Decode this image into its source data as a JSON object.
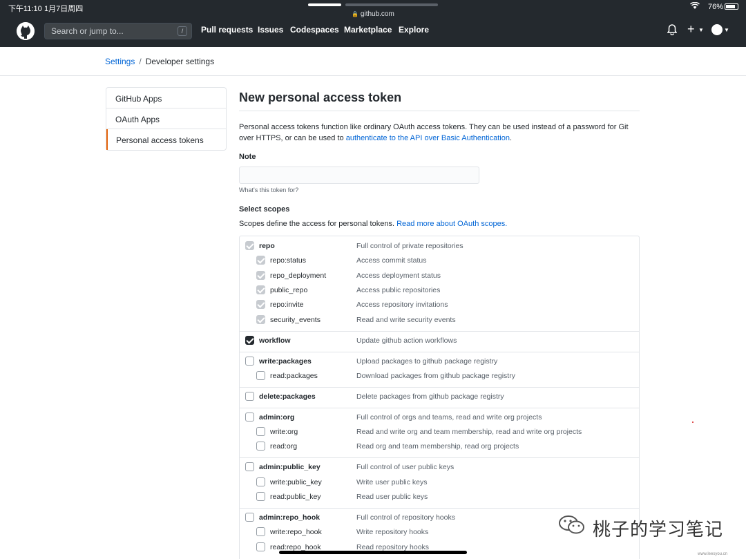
{
  "status_bar": {
    "time": "下午11:10",
    "date": "1月7日周四",
    "url": "github.com",
    "battery": "76%"
  },
  "header": {
    "search_placeholder": "Search or jump to...",
    "search_shortcut": "/",
    "nav": [
      "Pull requests",
      "Issues",
      "Codespaces",
      "Marketplace",
      "Explore"
    ],
    "plus": "+"
  },
  "breadcrumb": {
    "parent": "Settings",
    "separator": "/",
    "current": "Developer settings"
  },
  "sidebar": {
    "items": [
      {
        "label": "GitHub Apps",
        "active": false
      },
      {
        "label": "OAuth Apps",
        "active": false
      },
      {
        "label": "Personal access tokens",
        "active": true
      }
    ]
  },
  "page": {
    "title": "New personal access token",
    "description": "Personal access tokens function like ordinary OAuth access tokens. They can be used instead of a password for Git over HTTPS, or can be used to",
    "description_link": "authenticate to the API over Basic Authentication",
    "description_end": ".",
    "note_label": "Note",
    "note_value": "",
    "note_hint": "What's this token for?",
    "scopes_label": "Select scopes",
    "scopes_description": "Scopes define the access for personal tokens.",
    "scopes_link": "Read more about OAuth scopes."
  },
  "scopes": [
    {
      "name": "repo",
      "description": "Full control of private repositories",
      "state": "disabled-checked",
      "children": [
        {
          "name": "repo:status",
          "description": "Access commit status",
          "state": "disabled-checked"
        },
        {
          "name": "repo_deployment",
          "description": "Access deployment status",
          "state": "disabled-checked"
        },
        {
          "name": "public_repo",
          "description": "Access public repositories",
          "state": "disabled-checked"
        },
        {
          "name": "repo:invite",
          "description": "Access repository invitations",
          "state": "disabled-checked"
        },
        {
          "name": "security_events",
          "description": "Read and write security events",
          "state": "disabled-checked"
        }
      ]
    },
    {
      "name": "workflow",
      "description": "Update github action workflows",
      "state": "checked",
      "children": []
    },
    {
      "name": "write:packages",
      "description": "Upload packages to github package registry",
      "state": "unchecked",
      "children": [
        {
          "name": "read:packages",
          "description": "Download packages from github package registry",
          "state": "unchecked"
        }
      ]
    },
    {
      "name": "delete:packages",
      "description": "Delete packages from github package registry",
      "state": "unchecked",
      "children": []
    },
    {
      "name": "admin:org",
      "description": "Full control of orgs and teams, read and write org projects",
      "state": "unchecked",
      "children": [
        {
          "name": "write:org",
          "description": "Read and write org and team membership, read and write org projects",
          "state": "unchecked"
        },
        {
          "name": "read:org",
          "description": "Read org and team membership, read org projects",
          "state": "unchecked"
        }
      ]
    },
    {
      "name": "admin:public_key",
      "description": "Full control of user public keys",
      "state": "unchecked",
      "children": [
        {
          "name": "write:public_key",
          "description": "Write user public keys",
          "state": "unchecked"
        },
        {
          "name": "read:public_key",
          "description": "Read user public keys",
          "state": "unchecked"
        }
      ]
    },
    {
      "name": "admin:repo_hook",
      "description": "Full control of repository hooks",
      "state": "unchecked",
      "children": [
        {
          "name": "write:repo_hook",
          "description": "Write repository hooks",
          "state": "unchecked"
        },
        {
          "name": "read:repo_hook",
          "description": "Read repository hooks",
          "state": "unchecked"
        }
      ]
    }
  ],
  "watermark": {
    "text": "桃子的学习笔记",
    "url": "www.leesyou.cn"
  }
}
